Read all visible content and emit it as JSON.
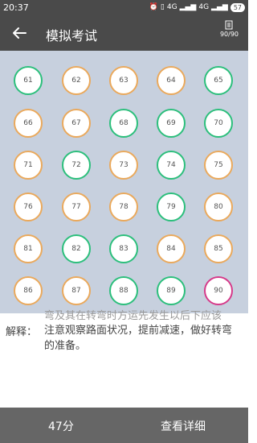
{
  "status": {
    "time": "20:37",
    "battery": "57",
    "net1": "4G",
    "net2": "4G"
  },
  "appbar": {
    "title": "模拟考试",
    "counter": "90/90"
  },
  "answer_grid": [
    {
      "num": "61",
      "status": "correct"
    },
    {
      "num": "62",
      "status": "wrong"
    },
    {
      "num": "63",
      "status": "wrong"
    },
    {
      "num": "64",
      "status": "wrong"
    },
    {
      "num": "65",
      "status": "correct"
    },
    {
      "num": "66",
      "status": "wrong"
    },
    {
      "num": "67",
      "status": "wrong"
    },
    {
      "num": "68",
      "status": "correct"
    },
    {
      "num": "69",
      "status": "correct"
    },
    {
      "num": "70",
      "status": "correct"
    },
    {
      "num": "71",
      "status": "wrong"
    },
    {
      "num": "72",
      "status": "correct"
    },
    {
      "num": "73",
      "status": "wrong"
    },
    {
      "num": "74",
      "status": "correct"
    },
    {
      "num": "75",
      "status": "wrong"
    },
    {
      "num": "76",
      "status": "wrong"
    },
    {
      "num": "77",
      "status": "wrong"
    },
    {
      "num": "78",
      "status": "wrong"
    },
    {
      "num": "79",
      "status": "correct"
    },
    {
      "num": "80",
      "status": "wrong"
    },
    {
      "num": "81",
      "status": "wrong"
    },
    {
      "num": "82",
      "status": "correct"
    },
    {
      "num": "83",
      "status": "correct"
    },
    {
      "num": "84",
      "status": "wrong"
    },
    {
      "num": "85",
      "status": "wrong"
    },
    {
      "num": "86",
      "status": "wrong"
    },
    {
      "num": "87",
      "status": "wrong"
    },
    {
      "num": "88",
      "status": "correct"
    },
    {
      "num": "89",
      "status": "correct"
    },
    {
      "num": "90",
      "status": "current"
    }
  ],
  "colors": {
    "correct": "#2cbf7c",
    "wrong": "#eaa95c",
    "current": "#d63a8a"
  },
  "explanation": {
    "fragment": "弯及其在转弯时方运先发生以后下应该",
    "label": "解释：",
    "text": "注意观察路面状况，提前减速，做好转弯的准备。"
  },
  "bottom": {
    "score": "47分",
    "detail_button": "查看详细"
  }
}
